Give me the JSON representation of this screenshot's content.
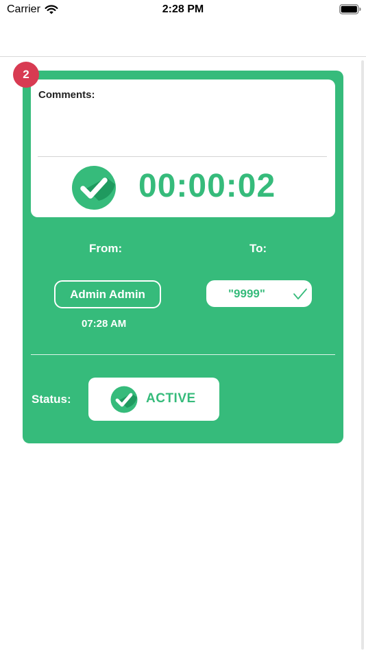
{
  "status_bar": {
    "carrier": "Carrier",
    "time": "2:28 PM",
    "icons": [
      "wifi-icon",
      "battery-icon"
    ]
  },
  "card": {
    "badge_count": "2",
    "comments_label": "Comments:",
    "comments_value": "",
    "timer": "00:00:02",
    "from_label": "From:",
    "to_label": "To:",
    "from_name": "Admin Admin",
    "from_time": "07:28 AM",
    "to_value": "\"9999\"",
    "status_label": "Status:",
    "status_value": "ACTIVE"
  },
  "colors": {
    "accent_green": "#36bb7b",
    "badge_red": "#d83b52",
    "white": "#ffffff"
  }
}
